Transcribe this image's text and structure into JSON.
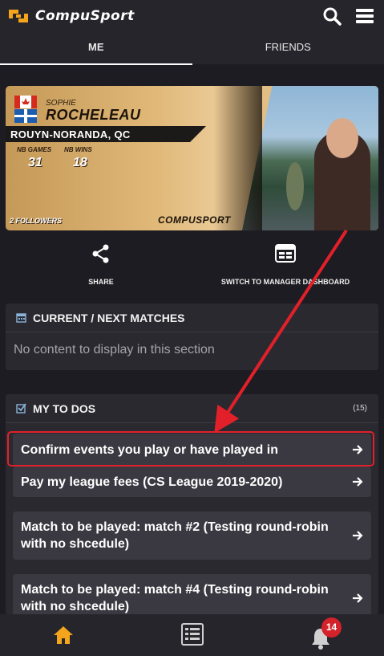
{
  "app": {
    "name": "CompuSport"
  },
  "header": {
    "icons": [
      "search-icon",
      "menu-icon"
    ]
  },
  "tabs": [
    {
      "label": "ME",
      "active": true
    },
    {
      "label": "FRIENDS",
      "active": false
    }
  ],
  "profile": {
    "first_name": "SOPHIE",
    "last_name": "ROCHELEAU",
    "city": "ROUYN-NORANDA, QC",
    "stats": [
      {
        "label": "NB GAMES",
        "value": "31"
      },
      {
        "label": "NB WINS",
        "value": "18"
      }
    ],
    "followers": "2 FOLLOWERS",
    "brand": "COMPUSPORT"
  },
  "actions": [
    {
      "label": "SHARE",
      "icon": "share-icon"
    },
    {
      "label": "SWITCH TO MANAGER DASHBOARD",
      "icon": "window-icon"
    }
  ],
  "matches_section": {
    "title": "CURRENT / NEXT MATCHES",
    "empty_text": "No content to display in this section"
  },
  "todos_section": {
    "title": "MY TO DOS",
    "count": "(15)",
    "items": [
      "Confirm events you play or have played in",
      "Pay my league fees (CS League 2019-2020)",
      "Match to be played: match #2 (Testing round-robin with no shcedule)",
      "Match to be played: match #4 (Testing round-robin with no shcedule)"
    ]
  },
  "bottom_nav": {
    "items": [
      "home-icon",
      "list-icon",
      "bell-icon"
    ],
    "notification_count": "14"
  },
  "colors": {
    "background": "#1d1c22",
    "panel": "#2a2930",
    "card_item": "#3a3941",
    "accent_home": "#f4a51c",
    "highlight": "#e2202a",
    "badge": "#d3222a"
  }
}
